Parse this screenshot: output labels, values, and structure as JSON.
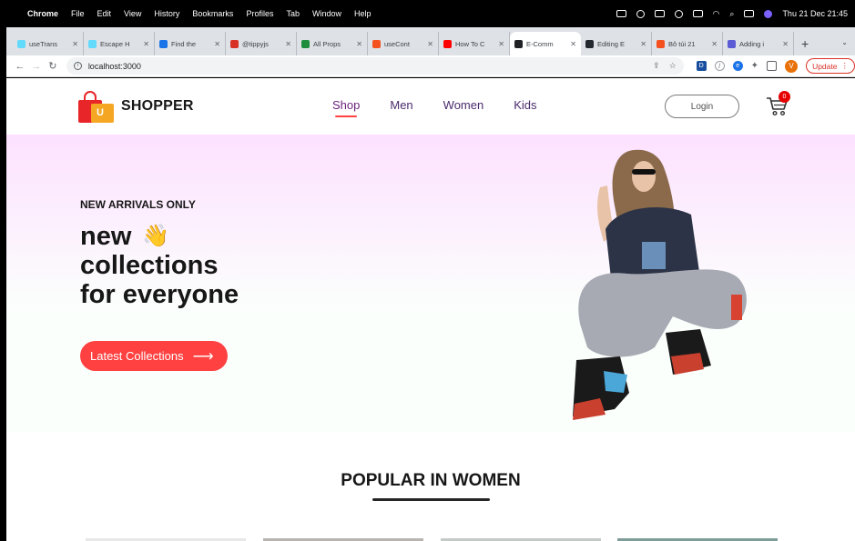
{
  "menubar": {
    "app": "Chrome",
    "items": [
      "File",
      "Edit",
      "View",
      "History",
      "Bookmarks",
      "Profiles",
      "Tab",
      "Window",
      "Help"
    ],
    "clock": "Thu 21 Dec  21:45"
  },
  "tabs": [
    {
      "label": "useTrans",
      "color": "#61dafb",
      "active": false
    },
    {
      "label": "Escape H",
      "color": "#61dafb",
      "active": false
    },
    {
      "label": "Find the",
      "color": "#1a73e8",
      "active": false
    },
    {
      "label": "@tippyjs",
      "color": "#d93025",
      "active": false
    },
    {
      "label": "All Props",
      "color": "#1e8e3e",
      "active": false
    },
    {
      "label": "useCont",
      "color": "#f4511e",
      "active": false
    },
    {
      "label": "How To C",
      "color": "#ff0000",
      "active": false
    },
    {
      "label": "E-Comm",
      "color": "#202124",
      "active": true
    },
    {
      "label": "Editing E",
      "color": "#24292f",
      "active": false
    },
    {
      "label": "Bô túi 21",
      "color": "#f4511e",
      "active": false
    },
    {
      "label": "Adding i",
      "color": "#5b5bd6",
      "active": false
    }
  ],
  "toolbar": {
    "url": "localhost:3000",
    "profile_initial": "V",
    "update_label": "Update"
  },
  "site": {
    "brand": "SHOPPER",
    "menu": [
      "Shop",
      "Men",
      "Women",
      "Kids"
    ],
    "active_menu": "Shop",
    "login_label": "Login",
    "cart_count": "0"
  },
  "hero": {
    "kicker": "NEW ARRIVALS ONLY",
    "title_line1": "new",
    "title_line2": "collections",
    "title_line3": "for everyone",
    "hand_emoji": "👋",
    "cta_label": "Latest Collections",
    "cta_arrow": "⟶"
  },
  "popular": {
    "title": "POPULAR IN WOMEN"
  },
  "colors": {
    "accent": "#ff4141",
    "hero_top": "#fde1ff",
    "text": "#171717"
  }
}
